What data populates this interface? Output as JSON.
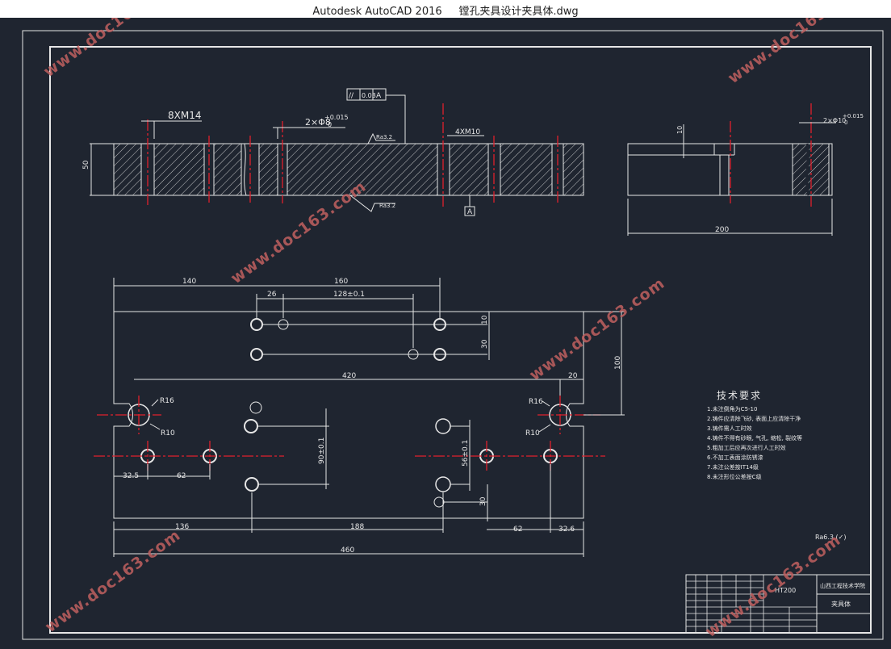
{
  "window": {
    "app": "Autodesk AutoCAD 2016",
    "file": "镗孔夹具设计夹具体.dwg",
    "colors": {
      "background": "#1f2530",
      "lines": "#e6e6e6",
      "centerlines": "#e0202c",
      "watermark": "#c06060"
    }
  },
  "watermark": "www.doc163.com",
  "views": {
    "front": {
      "callout_threads": "8XM14",
      "callout_holes": "2×Φ8",
      "tol_upper": "+0.015",
      "tol_lower": "0",
      "roughness_top": "Ra3.2",
      "roughness_bottom": "Ra3.2",
      "callout_m10": "4XM10",
      "height_dim": "50",
      "datum": "A",
      "gdt_symbol": "//",
      "gdt_value": "0.03",
      "gdt_datum": "A"
    },
    "side": {
      "dim_10": "10",
      "callout": "2×Φ10",
      "tol_upper": "+0.015",
      "tol_lower": "0",
      "width_dim": "200"
    },
    "plan": {
      "dims": {
        "d140": "140",
        "d160": "160",
        "d26": "26",
        "d128": "128±0.1",
        "d10": "10",
        "d30a": "30",
        "d100": "100",
        "d420": "420",
        "d20": "20",
        "d90": "90±0.1",
        "d56": "56±0.1",
        "d30b": "30",
        "d32": "32.5",
        "d62a": "62",
        "d136": "136",
        "d188": "188",
        "d62b": "62",
        "d326": "32.6",
        "d460": "460"
      },
      "radii": {
        "r16a": "R16",
        "r10a": "R10",
        "r16b": "R16",
        "r10b": "R10"
      }
    }
  },
  "tech": {
    "title": "技术要求",
    "items": [
      "1.未注倒角为C5-10",
      "2.铸件应清除飞砂, 表面上应清除干净",
      "3.铸件需人工时效",
      "4.铸件不得有砂眼, 气孔, 缩松, 裂纹等",
      "5.粗加工后应再次进行人工时效",
      "6.不加工表面涂防锈漆",
      "7.未注公差按IT14级",
      "8.未注形位公差按C级"
    ],
    "roughness_general": "Ra6.3 (✓)"
  },
  "title_block": {
    "school": "山西工程技术学院",
    "material": "HT200",
    "part_name": "夹具体"
  }
}
